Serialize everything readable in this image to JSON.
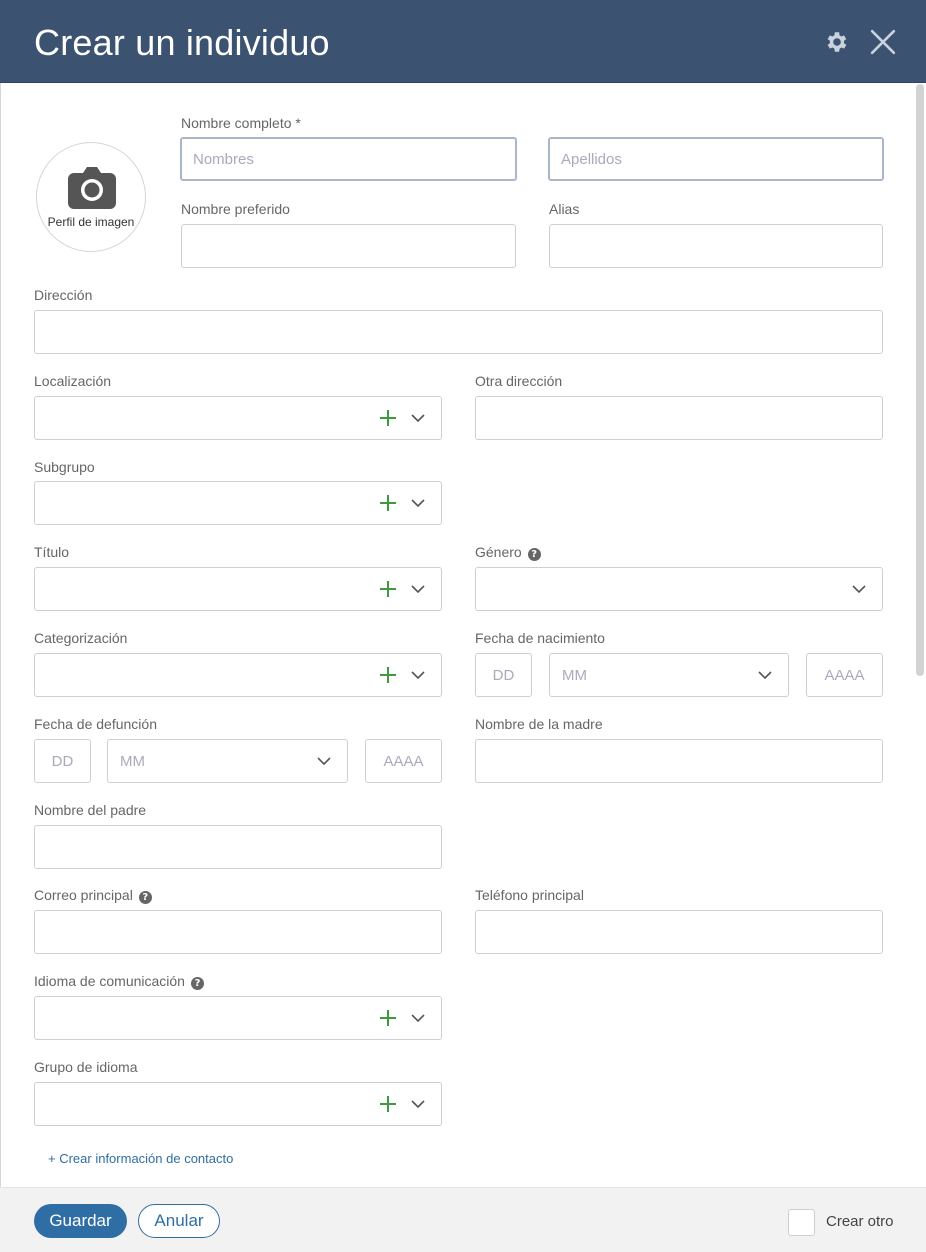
{
  "header": {
    "title": "Crear un individuo",
    "settings_icon": "gear-icon",
    "close_icon": "close-icon"
  },
  "avatar": {
    "icon": "camera-icon",
    "caption": "Perfil de imagen"
  },
  "fields": {
    "nombre_completo": {
      "label": "Nombre completo *",
      "first_placeholder": "Nombres",
      "last_placeholder": "Apellidos"
    },
    "nombre_preferido": {
      "label": "Nombre preferido"
    },
    "alias": {
      "label": "Alias"
    },
    "direccion": {
      "label": "Dirección"
    },
    "localizacion": {
      "label": "Localización"
    },
    "otra_direccion": {
      "label": "Otra dirección"
    },
    "subgrupo": {
      "label": "Subgrupo"
    },
    "titulo": {
      "label": "Título"
    },
    "genero": {
      "label": "Género"
    },
    "categorizacion": {
      "label": "Categorización"
    },
    "fecha_nacimiento": {
      "label": "Fecha de nacimiento",
      "day_placeholder": "DD",
      "month_placeholder": "MM",
      "year_placeholder": "AAAA"
    },
    "fecha_defuncion": {
      "label": "Fecha de defunción",
      "day_placeholder": "DD",
      "month_placeholder": "MM",
      "year_placeholder": "AAAA"
    },
    "nombre_madre": {
      "label": "Nombre de la madre"
    },
    "nombre_padre": {
      "label": "Nombre del padre"
    },
    "correo_principal": {
      "label": "Correo principal"
    },
    "telefono_principal": {
      "label": "Teléfono principal"
    },
    "idioma_comunicacion": {
      "label": "Idioma de comunicación"
    },
    "grupo_idioma": {
      "label": "Grupo de idioma"
    }
  },
  "create_contact_link": "+ Crear información de contacto",
  "footer": {
    "save_label": "Guardar",
    "cancel_label": "Anular",
    "create_another_label": "Crear otro"
  },
  "colors": {
    "header_bg": "#3b5270",
    "primary": "#2f6ea5",
    "add_icon": "#3d9a3d"
  }
}
